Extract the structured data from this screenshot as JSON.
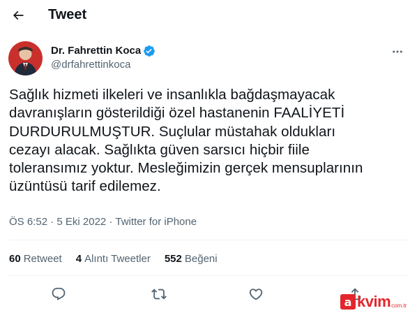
{
  "header": {
    "title": "Tweet"
  },
  "author": {
    "name": "Dr. Fahrettin Koca",
    "handle": "@drfahrettinkoca",
    "verified": true
  },
  "tweet": {
    "text": "Sağlık hizmeti ilkeleri ve insanlıkla bağdaşmayacak\ndavranışların gösterildiği özel hastanenin FAALİYETİ\nDURDURULMUŞTUR. Suçlular müstahak oldukları\ncezayı alacak. Sağlıkta güven sarsıcı hiçbir fiile\ntoleransımız yoktur. Mesleğimizin gerçek mensuplarının\nüzüntüsü tarif edilemez.",
    "time": "ÖS 6:52",
    "separator1": "·",
    "date": "5 Eki 2022",
    "separator2": "·",
    "source": "Twitter for iPhone"
  },
  "stats": {
    "retweets": {
      "count": "60",
      "label": "Retweet"
    },
    "quotes": {
      "count": "4",
      "label": "Alıntı Tweetler"
    },
    "likes": {
      "count": "552",
      "label": "Beğeni"
    }
  },
  "watermark": {
    "badge": "a",
    "text": "kvim",
    "sub": "com.tr"
  },
  "icons": {
    "back": "arrow-left-icon",
    "more": "more-horizontal-icon",
    "reply": "reply-icon",
    "retweet": "retweet-icon",
    "like": "heart-icon",
    "share": "share-icon"
  },
  "colors": {
    "text": "#0f1419",
    "secondary": "#536471",
    "verified": "#1d9bf0",
    "watermark": "#e3262b"
  }
}
